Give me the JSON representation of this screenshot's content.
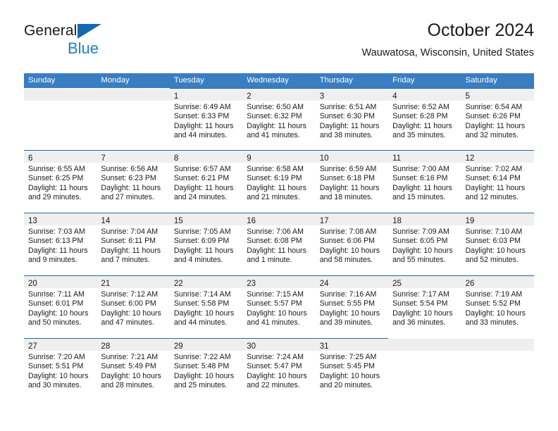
{
  "brand": {
    "line1": "General",
    "line2": "Blue",
    "triangle_color": "#1569b1",
    "blue_text_color": "#1b7fc4"
  },
  "header": {
    "title": "October 2024",
    "subtitle": "Wauwatosa, Wisconsin, United States"
  },
  "theme": {
    "header_row_bg": "#3a7ec1",
    "cell_border": "#1d6ca8",
    "daynum_band_bg": "#efefef",
    "text": "#1a1a1a"
  },
  "calendar": {
    "weekday_headers": [
      "Sunday",
      "Monday",
      "Tuesday",
      "Wednesday",
      "Thursday",
      "Friday",
      "Saturday"
    ],
    "weeks": [
      [
        {
          "day": "",
          "empty": true
        },
        {
          "day": "",
          "empty": true
        },
        {
          "day": "1",
          "sunrise": "Sunrise: 6:49 AM",
          "sunset": "Sunset: 6:33 PM",
          "daylight": "Daylight: 11 hours and 44 minutes."
        },
        {
          "day": "2",
          "sunrise": "Sunrise: 6:50 AM",
          "sunset": "Sunset: 6:32 PM",
          "daylight": "Daylight: 11 hours and 41 minutes."
        },
        {
          "day": "3",
          "sunrise": "Sunrise: 6:51 AM",
          "sunset": "Sunset: 6:30 PM",
          "daylight": "Daylight: 11 hours and 38 minutes."
        },
        {
          "day": "4",
          "sunrise": "Sunrise: 6:52 AM",
          "sunset": "Sunset: 6:28 PM",
          "daylight": "Daylight: 11 hours and 35 minutes."
        },
        {
          "day": "5",
          "sunrise": "Sunrise: 6:54 AM",
          "sunset": "Sunset: 6:26 PM",
          "daylight": "Daylight: 11 hours and 32 minutes."
        }
      ],
      [
        {
          "day": "6",
          "sunrise": "Sunrise: 6:55 AM",
          "sunset": "Sunset: 6:25 PM",
          "daylight": "Daylight: 11 hours and 29 minutes."
        },
        {
          "day": "7",
          "sunrise": "Sunrise: 6:56 AM",
          "sunset": "Sunset: 6:23 PM",
          "daylight": "Daylight: 11 hours and 27 minutes."
        },
        {
          "day": "8",
          "sunrise": "Sunrise: 6:57 AM",
          "sunset": "Sunset: 6:21 PM",
          "daylight": "Daylight: 11 hours and 24 minutes."
        },
        {
          "day": "9",
          "sunrise": "Sunrise: 6:58 AM",
          "sunset": "Sunset: 6:19 PM",
          "daylight": "Daylight: 11 hours and 21 minutes."
        },
        {
          "day": "10",
          "sunrise": "Sunrise: 6:59 AM",
          "sunset": "Sunset: 6:18 PM",
          "daylight": "Daylight: 11 hours and 18 minutes."
        },
        {
          "day": "11",
          "sunrise": "Sunrise: 7:00 AM",
          "sunset": "Sunset: 6:16 PM",
          "daylight": "Daylight: 11 hours and 15 minutes."
        },
        {
          "day": "12",
          "sunrise": "Sunrise: 7:02 AM",
          "sunset": "Sunset: 6:14 PM",
          "daylight": "Daylight: 11 hours and 12 minutes."
        }
      ],
      [
        {
          "day": "13",
          "sunrise": "Sunrise: 7:03 AM",
          "sunset": "Sunset: 6:13 PM",
          "daylight": "Daylight: 11 hours and 9 minutes."
        },
        {
          "day": "14",
          "sunrise": "Sunrise: 7:04 AM",
          "sunset": "Sunset: 6:11 PM",
          "daylight": "Daylight: 11 hours and 7 minutes."
        },
        {
          "day": "15",
          "sunrise": "Sunrise: 7:05 AM",
          "sunset": "Sunset: 6:09 PM",
          "daylight": "Daylight: 11 hours and 4 minutes."
        },
        {
          "day": "16",
          "sunrise": "Sunrise: 7:06 AM",
          "sunset": "Sunset: 6:08 PM",
          "daylight": "Daylight: 11 hours and 1 minute."
        },
        {
          "day": "17",
          "sunrise": "Sunrise: 7:08 AM",
          "sunset": "Sunset: 6:06 PM",
          "daylight": "Daylight: 10 hours and 58 minutes."
        },
        {
          "day": "18",
          "sunrise": "Sunrise: 7:09 AM",
          "sunset": "Sunset: 6:05 PM",
          "daylight": "Daylight: 10 hours and 55 minutes."
        },
        {
          "day": "19",
          "sunrise": "Sunrise: 7:10 AM",
          "sunset": "Sunset: 6:03 PM",
          "daylight": "Daylight: 10 hours and 52 minutes."
        }
      ],
      [
        {
          "day": "20",
          "sunrise": "Sunrise: 7:11 AM",
          "sunset": "Sunset: 6:01 PM",
          "daylight": "Daylight: 10 hours and 50 minutes."
        },
        {
          "day": "21",
          "sunrise": "Sunrise: 7:12 AM",
          "sunset": "Sunset: 6:00 PM",
          "daylight": "Daylight: 10 hours and 47 minutes."
        },
        {
          "day": "22",
          "sunrise": "Sunrise: 7:14 AM",
          "sunset": "Sunset: 5:58 PM",
          "daylight": "Daylight: 10 hours and 44 minutes."
        },
        {
          "day": "23",
          "sunrise": "Sunrise: 7:15 AM",
          "sunset": "Sunset: 5:57 PM",
          "daylight": "Daylight: 10 hours and 41 minutes."
        },
        {
          "day": "24",
          "sunrise": "Sunrise: 7:16 AM",
          "sunset": "Sunset: 5:55 PM",
          "daylight": "Daylight: 10 hours and 39 minutes."
        },
        {
          "day": "25",
          "sunrise": "Sunrise: 7:17 AM",
          "sunset": "Sunset: 5:54 PM",
          "daylight": "Daylight: 10 hours and 36 minutes."
        },
        {
          "day": "26",
          "sunrise": "Sunrise: 7:19 AM",
          "sunset": "Sunset: 5:52 PM",
          "daylight": "Daylight: 10 hours and 33 minutes."
        }
      ],
      [
        {
          "day": "27",
          "sunrise": "Sunrise: 7:20 AM",
          "sunset": "Sunset: 5:51 PM",
          "daylight": "Daylight: 10 hours and 30 minutes."
        },
        {
          "day": "28",
          "sunrise": "Sunrise: 7:21 AM",
          "sunset": "Sunset: 5:49 PM",
          "daylight": "Daylight: 10 hours and 28 minutes."
        },
        {
          "day": "29",
          "sunrise": "Sunrise: 7:22 AM",
          "sunset": "Sunset: 5:48 PM",
          "daylight": "Daylight: 10 hours and 25 minutes."
        },
        {
          "day": "30",
          "sunrise": "Sunrise: 7:24 AM",
          "sunset": "Sunset: 5:47 PM",
          "daylight": "Daylight: 10 hours and 22 minutes."
        },
        {
          "day": "31",
          "sunrise": "Sunrise: 7:25 AM",
          "sunset": "Sunset: 5:45 PM",
          "daylight": "Daylight: 10 hours and 20 minutes."
        },
        {
          "day": "",
          "empty": true
        },
        {
          "day": "",
          "empty": true
        }
      ]
    ]
  }
}
